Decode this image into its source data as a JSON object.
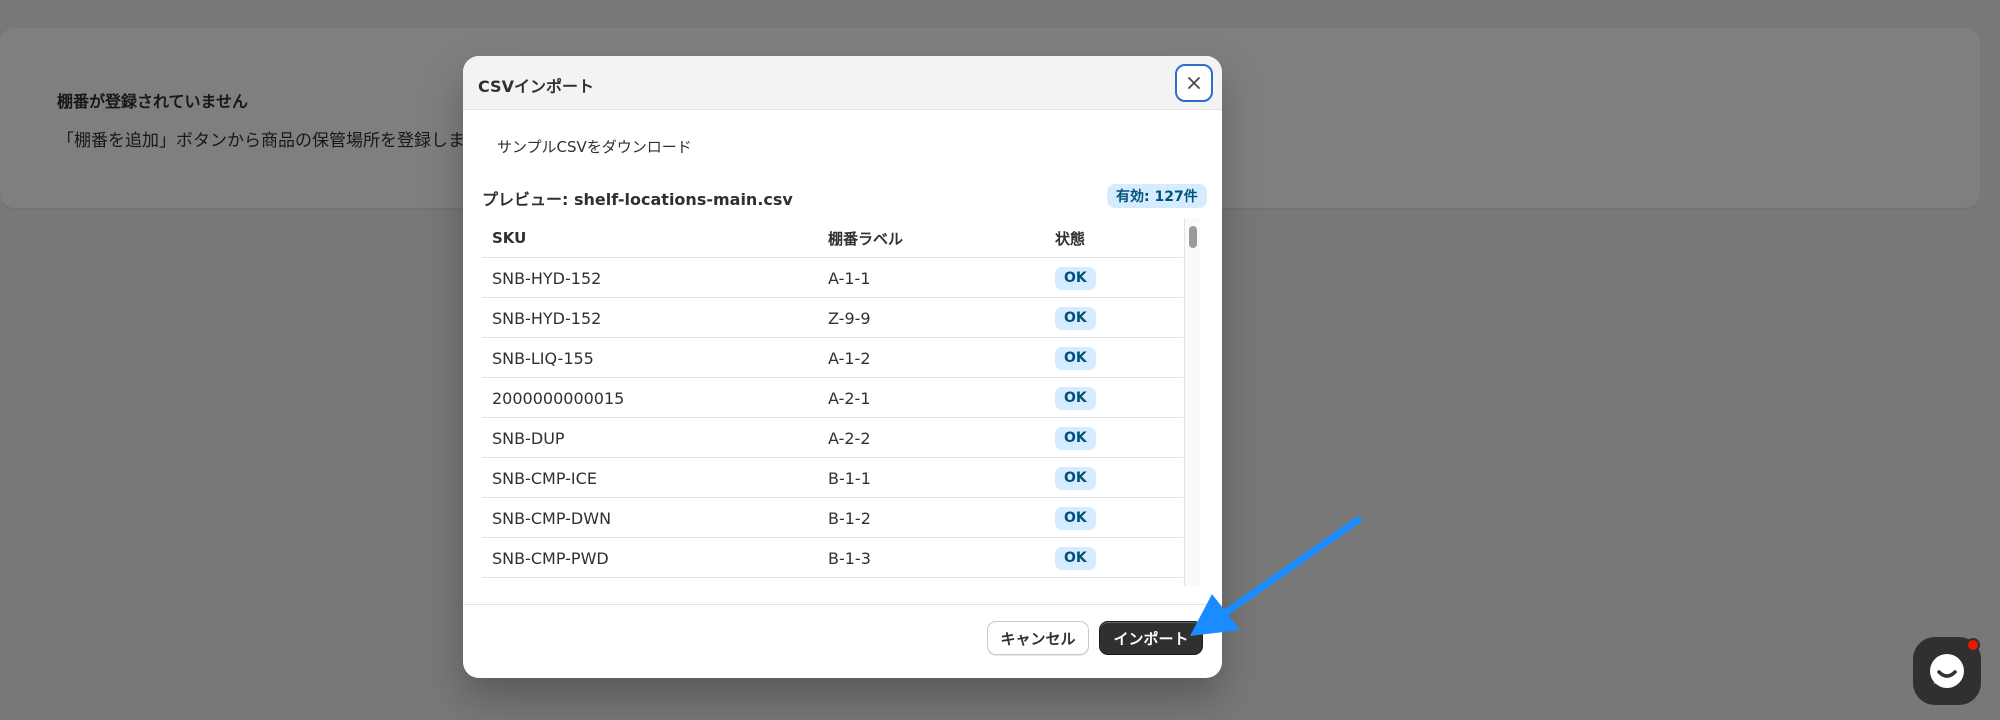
{
  "background": {
    "title": "棚番が登録されていません",
    "description": "「棚番を追加」ボタンから商品の保管場所を登録しましょう"
  },
  "modal": {
    "title": "CSVインポート",
    "download_label": "サンプルCSVをダウンロード",
    "preview_label": "プレビュー: shelf-locations-main.csv",
    "valid_badge": "有効: 127件",
    "columns": {
      "sku": "SKU",
      "label": "棚番ラベル",
      "status": "状態"
    },
    "rows": [
      {
        "sku": "SNB-HYD-152",
        "label": "A-1-1",
        "status": "OK"
      },
      {
        "sku": "SNB-HYD-152",
        "label": "Z-9-9",
        "status": "OK"
      },
      {
        "sku": "SNB-LIQ-155",
        "label": "A-1-2",
        "status": "OK"
      },
      {
        "sku": "2000000000015",
        "label": "A-2-1",
        "status": "OK"
      },
      {
        "sku": "SNB-DUP",
        "label": "A-2-2",
        "status": "OK"
      },
      {
        "sku": "SNB-CMP-ICE",
        "label": "B-1-1",
        "status": "OK"
      },
      {
        "sku": "SNB-CMP-DWN",
        "label": "B-1-2",
        "status": "OK"
      },
      {
        "sku": "SNB-CMP-PWD",
        "label": "B-1-3",
        "status": "OK"
      }
    ],
    "cancel_label": "キャンセル",
    "import_label": "インポート"
  },
  "icons": {
    "close": "close-icon",
    "chat": "chat-icon"
  },
  "colors": {
    "badge_bg": "#d5ebff",
    "badge_text": "#00527c",
    "primary_button": "#303030",
    "annotation_arrow": "#1a8cff"
  }
}
